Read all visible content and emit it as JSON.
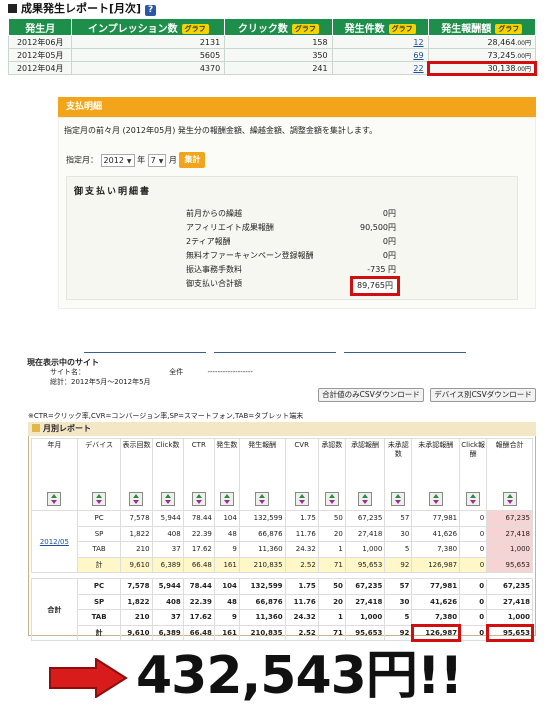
{
  "section1": {
    "title": "成果発生レポート[月次]",
    "help": "?",
    "graph_label": "グラフ",
    "columns": [
      "発生月",
      "インプレッション数",
      "クリック数",
      "発生件数",
      "発生報酬額"
    ],
    "rows": [
      {
        "month": "2012年06月",
        "impressions": "2131",
        "clicks": "158",
        "count": "12",
        "reward": "28,464",
        "unit": ".00円"
      },
      {
        "month": "2012年05月",
        "impressions": "5605",
        "clicks": "350",
        "count": "69",
        "reward": "73,245",
        "unit": ".00円"
      },
      {
        "month": "2012年04月",
        "impressions": "4370",
        "clicks": "241",
        "count": "22",
        "reward": "30,138",
        "unit": ".00円"
      }
    ]
  },
  "payment": {
    "header": "支払明細",
    "description": "指定月の前々月 (2012年05月) 発生分の報酬金額、繰越金額、調整金額を集計します。",
    "spec_label": "指定月：",
    "year_value": "2012",
    "year_suffix": "年",
    "month_value": "7",
    "month_suffix": "月",
    "submit": "集計",
    "statement_title": "御支払い明細書",
    "lines": [
      {
        "label": "前月からの繰越",
        "value": "0円"
      },
      {
        "label": "アフィリエイト成果報酬",
        "value": "90,500円"
      },
      {
        "label": "2ティア報酬",
        "value": "0円"
      },
      {
        "label": "無料オファーキャンペーン登録報酬",
        "value": "0円"
      },
      {
        "label": "振込事務手数料",
        "value": "-735 円"
      },
      {
        "label": "御支払い合計額",
        "value": "89,765円"
      }
    ]
  },
  "site": {
    "heading": "現在表示中のサイト",
    "name_label": "サイト名：",
    "name_value": "全件",
    "name_dashes": "------------------",
    "period_label": "総計：",
    "period_value": "2012年5月〜2012年5月",
    "csv_total": "合計値のみCSVダウンロード",
    "csv_device": "デバイス別CSVダウンロード"
  },
  "note": "※CTR=クリック率,CVR=コンバージョン率,SP=スマートフォン,TAB=タブレット端末",
  "monthly": {
    "title": "月別レポート",
    "headers": [
      "年月",
      "デバイス",
      "表示回数",
      "Click数",
      "CTR",
      "発生数",
      "発生報酬",
      "CVR",
      "承認数",
      "承認報酬",
      "未承認数",
      "未承認報酬",
      "Click報酬",
      "報酬合計"
    ],
    "month_link": "2012/05",
    "month_rows": [
      [
        "PC",
        "7,578",
        "5,944",
        "78.44",
        "104",
        "132,599",
        "1.75",
        "50",
        "67,235",
        "57",
        "77,981",
        "0",
        "67,235"
      ],
      [
        "SP",
        "1,822",
        "408",
        "22.39",
        "48",
        "66,876",
        "11.76",
        "20",
        "27,418",
        "30",
        "41,626",
        "0",
        "27,418"
      ],
      [
        "TAB",
        "210",
        "37",
        "17.62",
        "9",
        "11,360",
        "24.32",
        "1",
        "1,000",
        "5",
        "7,380",
        "0",
        "1,000"
      ],
      [
        "計",
        "9,610",
        "6,389",
        "66.48",
        "161",
        "210,835",
        "2.52",
        "71",
        "95,653",
        "92",
        "126,987",
        "0",
        "95,653"
      ]
    ],
    "total_label": "合計",
    "total_rows": [
      [
        "PC",
        "7,578",
        "5,944",
        "78.44",
        "104",
        "132,599",
        "1.75",
        "50",
        "67,235",
        "57",
        "77,981",
        "0",
        "67,235"
      ],
      [
        "SP",
        "1,822",
        "408",
        "22.39",
        "48",
        "66,876",
        "11.76",
        "20",
        "27,418",
        "30",
        "41,626",
        "0",
        "27,418"
      ],
      [
        "TAB",
        "210",
        "37",
        "17.62",
        "9",
        "11,360",
        "24.32",
        "1",
        "1,000",
        "5",
        "7,380",
        "0",
        "1,000"
      ],
      [
        "計",
        "9,610",
        "6,389",
        "66.48",
        "161",
        "210,835",
        "2.52",
        "71",
        "95,653",
        "92",
        "126,987",
        "0",
        "95,653"
      ]
    ]
  },
  "big_total": "432,543円!!",
  "colors": {
    "green": "#1e8f4a",
    "orange": "#f2a51a",
    "red": "#d30e0e"
  }
}
